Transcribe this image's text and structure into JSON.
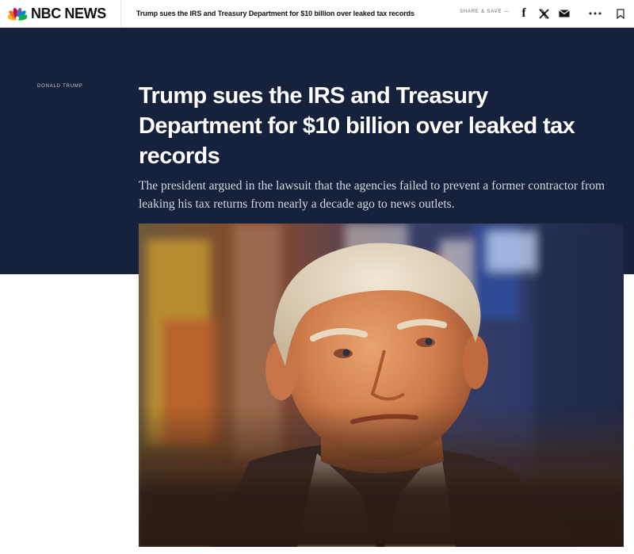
{
  "header": {
    "logo_text": "NBC NEWS",
    "article_title_short": "Trump sues the IRS and Treasury Department for $10 billion over leaked tax records",
    "share_label": "SHARE & SAVE —",
    "icons": [
      "facebook-icon",
      "x-icon",
      "mail-icon",
      "more-icon",
      "bookmark-icon"
    ]
  },
  "article": {
    "label": "DONALD TRUMP",
    "title": "Trump sues the IRS and Treasury Department for $10 billion over leaked tax records",
    "dek": "The president argued in the lawsuit that the agencies failed to prevent a former contractor from leaking his tax returns from nearly a decade ago to news outlets."
  },
  "colors": {
    "hero_background": "#16213c",
    "peacock": [
      "#fcb711",
      "#f37021",
      "#cc004c",
      "#6460aa",
      "#0089d0",
      "#0db14b"
    ]
  }
}
